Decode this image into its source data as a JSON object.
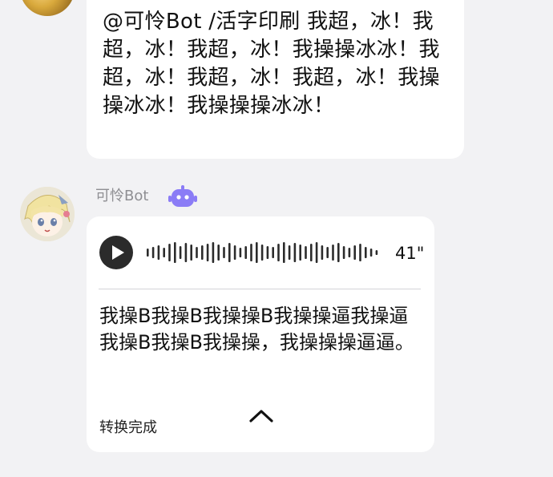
{
  "message_top": {
    "text": "@可怜Bot /活字印刷 我超，冰！我超，冰！我超，冰！我操操冰冰！我超，冰！我超，冰！我超，冰！我操操冰冰！我操操操冰冰！"
  },
  "bot_message": {
    "sender_name": "可怜Bot",
    "badge_icon": "robot-icon",
    "badge_color": "#8b7cf6",
    "voice": {
      "duration": "41\"",
      "play_icon": "play-icon",
      "waveform_bars": [
        10,
        14,
        18,
        12,
        22,
        26,
        16,
        24,
        20,
        14,
        18,
        22,
        26,
        20,
        14,
        24,
        18,
        12,
        16,
        22,
        26,
        20,
        16,
        14,
        22,
        26,
        18,
        24,
        20,
        16,
        22,
        26,
        18,
        14,
        20,
        24,
        16,
        12,
        18,
        22,
        14,
        10,
        6
      ]
    },
    "transcript": "我操B我操B我操操B我操操逼我操逼我操B我操B我操操，我操操操逼逼。",
    "convert_status": "转换完成",
    "collapse_icon": "chevron-up-icon"
  }
}
